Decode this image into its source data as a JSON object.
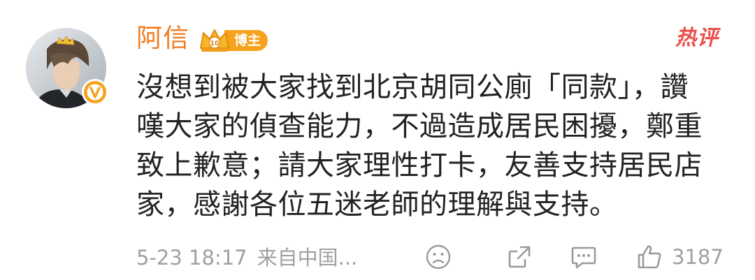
{
  "comment": {
    "username": "阿信",
    "badge_label": "博主",
    "hot_label": "热评",
    "text": "沒想到被大家找到北京胡同公廁「同款」，讚\n嘆大家的偵查能力，不過造成居民困擾，鄭重\n致上歉意；請大家理性打卡，友善支持居民店\n家，感謝各位五迷老師的理解與支持。",
    "date": "5-23 18:17",
    "source": "来自中国...",
    "like_count": "3187"
  },
  "icons": {
    "avatar": "avatar",
    "verified": "verified-v-icon",
    "crown": "crown-icon",
    "emoji": "emoji-face-icon",
    "share": "share-icon",
    "comment": "comment-icon",
    "like": "thumbs-up-icon"
  },
  "colors": {
    "username": "#f07c1f",
    "badge": "#f7a21c",
    "hot": "#e9504a",
    "text": "#222222",
    "meta": "#a0a0a0"
  }
}
